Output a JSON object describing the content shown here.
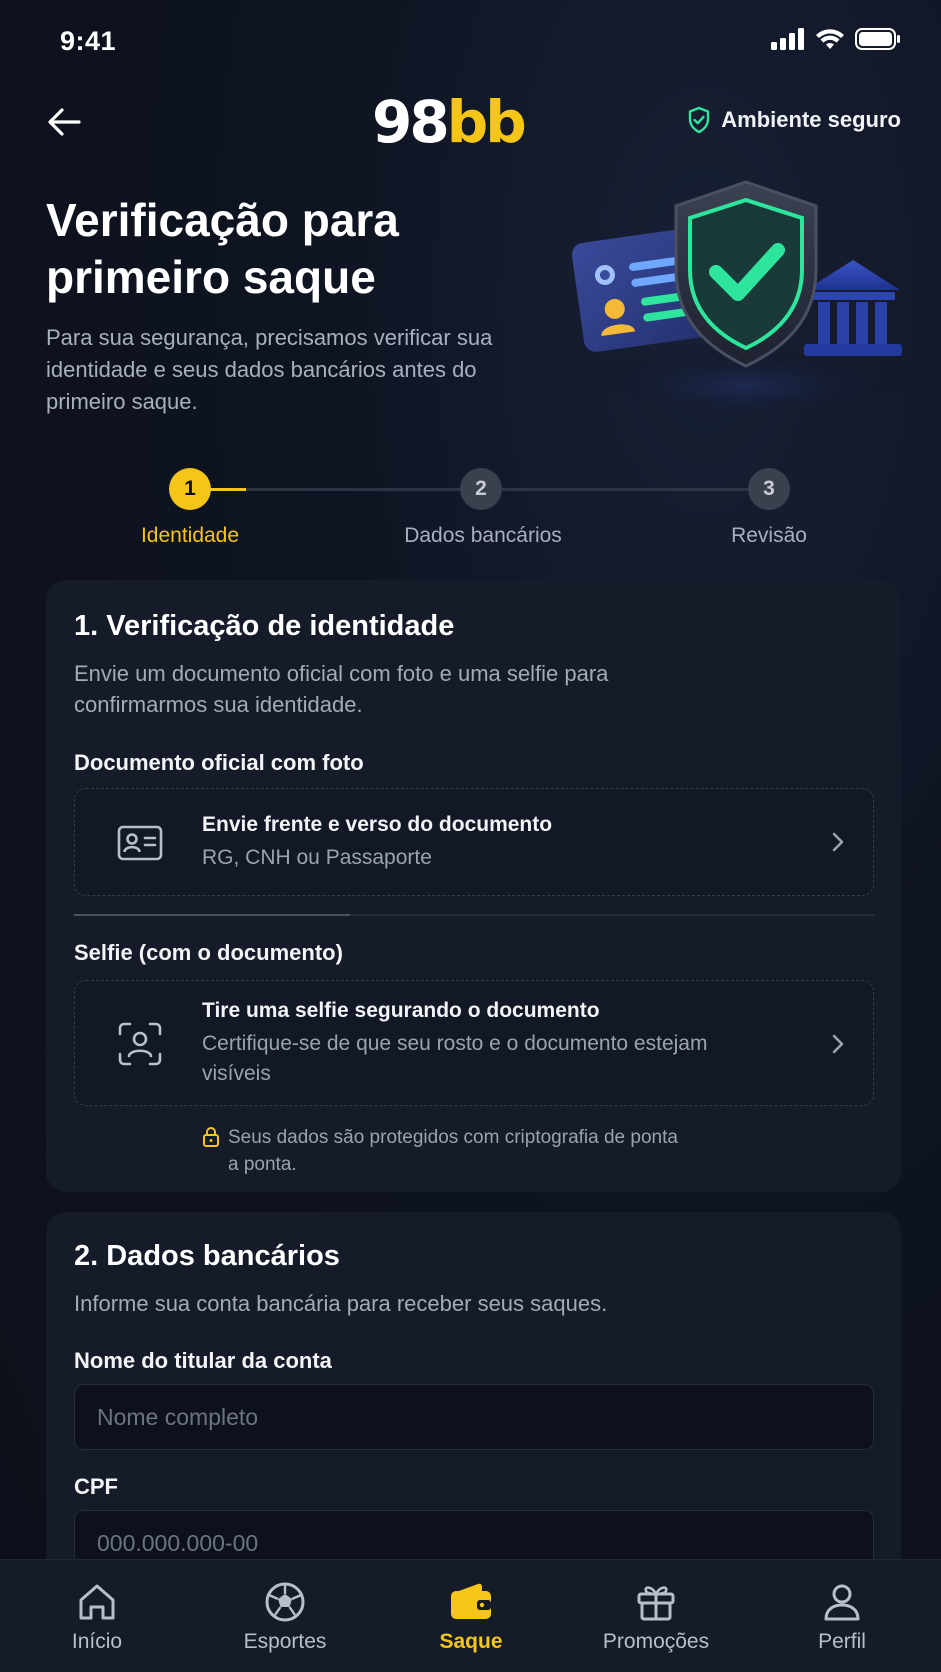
{
  "status_bar": {
    "time": "9:41"
  },
  "header": {
    "logo_part1": "98",
    "logo_part2": "bb",
    "secure_label": "Ambiente seguro"
  },
  "hero": {
    "title": "Verificação para primeiro saque",
    "subtitle": "Para sua segurança, precisamos verificar sua identidade e seus dados bancários antes do primeiro saque."
  },
  "stepper": {
    "steps": [
      {
        "number": "1",
        "label": "Identidade",
        "state": "active"
      },
      {
        "number": "2",
        "label": "Dados bancários",
        "state": "inactive"
      },
      {
        "number": "3",
        "label": "Revisão",
        "state": "inactive"
      }
    ]
  },
  "identity_card": {
    "title": "1. Verificação de identidade",
    "description": "Envie um documento oficial com foto e uma selfie para confirmarmos sua identidade.",
    "document": {
      "label": "Documento oficial com foto",
      "title": "Envie frente e verso do documento",
      "subtitle": "RG, CNH ou Passaporte",
      "icon": "id-card-icon"
    },
    "selfie": {
      "label": "Selfie (com o documento)",
      "title": "Tire uma selfie segurando o documento",
      "subtitle": "Certifique-se de que seu rosto e o documento estejam visíveis",
      "icon": "face-scan-icon"
    },
    "privacy_note": "Seus dados são protegidos com criptografia de ponta a ponta."
  },
  "bank_card": {
    "title": "2. Dados bancários",
    "description": "Informe sua conta bancária para receber seus saques.",
    "holder": {
      "label": "Nome do titular da conta",
      "placeholder": "Nome completo"
    },
    "cpf": {
      "label": "CPF",
      "placeholder": "000.000.000-00"
    }
  },
  "bottom_nav": {
    "items": [
      {
        "label": "Início",
        "icon": "home-icon"
      },
      {
        "label": "Esportes",
        "icon": "soccer-ball-icon"
      },
      {
        "label": "Saque",
        "icon": "wallet-icon",
        "active": true
      },
      {
        "label": "Promoções",
        "icon": "gift-icon"
      },
      {
        "label": "Perfil",
        "icon": "user-icon"
      }
    ]
  },
  "colors": {
    "background": "#0d111b",
    "card": "#151b28",
    "accent": "#f5c518",
    "secure_green": "#2ee59d",
    "text_muted": "#a3aab8"
  }
}
